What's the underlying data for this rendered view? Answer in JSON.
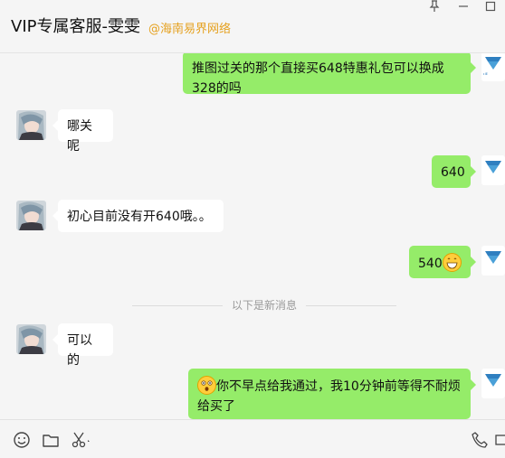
{
  "header": {
    "title": "VIP专属客服-雯雯",
    "subtitle": "@海南易界网络"
  },
  "window_controls": {
    "pin": "pin-icon",
    "minimize": "minimize-icon",
    "maximize": "maximize-icon"
  },
  "messages": [
    {
      "side": "out",
      "text": "推图过关的那个直接买648特惠礼包可以换成328的吗"
    },
    {
      "side": "in",
      "text": "哪关呢"
    },
    {
      "side": "out",
      "text": "640"
    },
    {
      "side": "in",
      "text": "初心目前没有开640哦。。"
    },
    {
      "side": "out",
      "text": "540",
      "emoji": "grinning-emoji"
    },
    {
      "side": "in",
      "text": "可以的"
    },
    {
      "side": "out",
      "emoji": "astonished-emoji",
      "text": "你不早点给我通过，我10分钟前等得不耐烦给买了"
    }
  ],
  "divider": {
    "text": "以下是新消息"
  },
  "toolbar": {
    "icons": [
      "emoji-icon",
      "folder-icon",
      "scissors-icon",
      "phone-icon",
      "video-icon"
    ]
  },
  "colors": {
    "out_bubble": "#95ec69",
    "in_bubble": "#ffffff",
    "subtitle": "#e5a11f",
    "background": "#f5f5f5"
  }
}
